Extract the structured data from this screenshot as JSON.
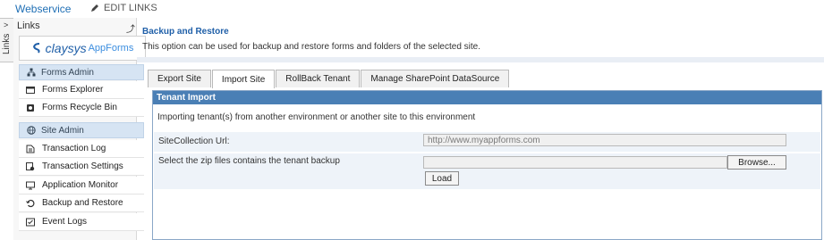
{
  "topbar": {
    "site_link": "Webservice",
    "edit_links": "EDIT LINKS"
  },
  "links_tab": {
    "label": "Links",
    "arrow": ">"
  },
  "sidebar": {
    "header": "Links",
    "pin": "⤴",
    "logo": {
      "brand": "claysys",
      "product": "AppForms"
    },
    "sections": [
      {
        "label": "Forms Admin",
        "icon": "org-chart-icon",
        "items": [
          {
            "label": "Forms Explorer",
            "icon": "form-icon"
          },
          {
            "label": "Forms Recycle Bin",
            "icon": "recycle-bin-icon"
          }
        ]
      },
      {
        "label": "Site Admin",
        "icon": "globe-icon",
        "items": [
          {
            "label": "Transaction Log",
            "icon": "log-icon"
          },
          {
            "label": "Transaction Settings",
            "icon": "settings-icon"
          },
          {
            "label": "Application Monitor",
            "icon": "monitor-icon"
          },
          {
            "label": "Backup and Restore",
            "icon": "restore-icon"
          },
          {
            "label": "Event Logs",
            "icon": "event-log-icon"
          }
        ]
      }
    ]
  },
  "page": {
    "title": "Backup and Restore",
    "description": "This option can be used for backup and restore forms and folders of the selected site."
  },
  "tabs": [
    {
      "label": "Export Site",
      "active": false
    },
    {
      "label": "Import Site",
      "active": true
    },
    {
      "label": "RollBack Tenant",
      "active": false
    },
    {
      "label": "Manage SharePoint DataSource",
      "active": false
    }
  ],
  "panel": {
    "header": "Tenant Import",
    "intro": "Importing tenant(s) from another environment or another site to this environment",
    "site_url_label": "SiteCollection Url:",
    "site_url_value": "http://www.myappforms.com",
    "zip_label": "Select the zip files contains the tenant backup",
    "file_value": "",
    "browse_label": "Browse...",
    "load_label": "Load"
  },
  "colors": {
    "accent": "#1f5fa8",
    "panel_header": "#4a7fb5",
    "section_bg": "#d6e4f3"
  }
}
